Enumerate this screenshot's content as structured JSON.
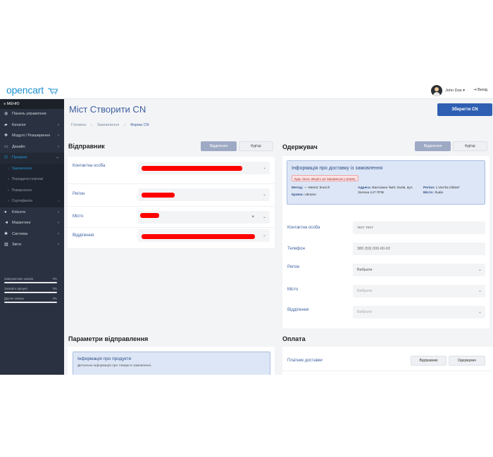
{
  "header": {
    "logo": "opencart",
    "user_name": "John Doe ▾",
    "logout": "⇥ Вихід"
  },
  "sidebar": {
    "menu_title": "≡ МЕНЮ",
    "items": [
      {
        "icon": "dashboard-icon",
        "glyph": "◍",
        "label": "Панель управління"
      },
      {
        "icon": "tag-icon",
        "glyph": "▰",
        "label": "Каталог"
      },
      {
        "icon": "puzzle-icon",
        "glyph": "✚",
        "label": "Модулі / Розширення"
      },
      {
        "icon": "monitor-icon",
        "glyph": "▭",
        "label": "Дизайн"
      },
      {
        "icon": "cart-icon",
        "glyph": "⊡",
        "label": "Продажі"
      },
      {
        "icon": "user-icon",
        "glyph": "●",
        "label": "Клієнти"
      },
      {
        "icon": "share-icon",
        "glyph": "◄",
        "label": "Маркетинг"
      },
      {
        "icon": "gear-icon",
        "glyph": "✱",
        "label": "Система"
      },
      {
        "icon": "chart-icon",
        "glyph": "▥",
        "label": "Звіти"
      }
    ],
    "subitems": [
      "Замовлення",
      "Періодичні платежі",
      "Повернення",
      "Сертифікати"
    ],
    "stats": [
      {
        "label": "Завершенних заказів",
        "value": "0%"
      },
      {
        "label": "Заказів в процесі",
        "value": "0%"
      },
      {
        "label": "Другие заказы",
        "value": "0%"
      }
    ]
  },
  "page": {
    "title": "Міст Створити CN",
    "save_label": "Зберегти CN",
    "breadcrumb": {
      "home": "Головна",
      "sep": "›",
      "orders": "Замовлення",
      "current": "Форма CN"
    }
  },
  "sender": {
    "heading": "Відправник",
    "tabs": [
      "Відділення",
      "Кур'єр"
    ],
    "fields": {
      "contact": "Контактна особа",
      "region": "Регіон",
      "city": "Місто",
      "branch": "Відділення"
    }
  },
  "receiver": {
    "heading": "Одержувач",
    "tabs": [
      "Відділення",
      "Кур'єр"
    ],
    "info": {
      "title": "Інформація про доставку із замовлення",
      "warning": "Будь ласка, введіть цю інформацію у форму.",
      "method_label": "Метод:",
      "method_value": "— Meest: branch",
      "country_label": "Країна:",
      "country_value": "Ukraine",
      "address_label": "Адреса:",
      "address_value": "Вантажне №01 Львів, вул. Зелена 147 ППВ",
      "region_label": "Регіон:",
      "region_value": "L'vivs'ka Oblast'",
      "city_label": "Місто:",
      "city_value": "Львів"
    },
    "contact": {
      "label": "Контактна особа",
      "value": "тест тест"
    },
    "phone": {
      "label": "Телефон",
      "value": "380 (50) 000-00-02"
    },
    "region": {
      "label": "Регіон",
      "value": "Вибрати"
    },
    "city": {
      "label": "Місто",
      "value": "Вибрати"
    },
    "branch": {
      "label": "Відділення",
      "value": "Вибрати"
    }
  },
  "params": {
    "heading": "Параметри відправлення",
    "info_title": "Інформація про продукти",
    "info_sub": "Детальна інформація про товари в замовленні."
  },
  "payment": {
    "heading": "Оплата",
    "payer_label": "Платник доставки",
    "options": [
      "Відправник",
      "Одержувач"
    ]
  },
  "colors": {
    "accent": "#3d5f9e",
    "button": "#2f5fb3",
    "sidebar": "#2a3140",
    "redaction": "#ff0000"
  }
}
